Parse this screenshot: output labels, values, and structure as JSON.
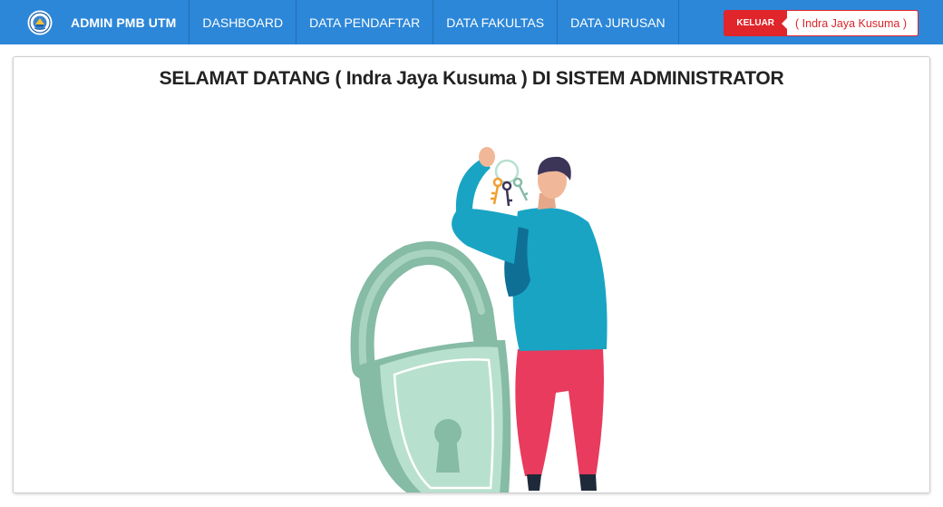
{
  "navbar": {
    "brand": "ADMIN PMB UTM",
    "items": [
      {
        "label": "DASHBOARD"
      },
      {
        "label": "DATA PENDAFTAR"
      },
      {
        "label": "DATA FAKULTAS"
      },
      {
        "label": "DATA JURUSAN"
      }
    ],
    "logout_label": "KELUAR",
    "user_label": "( Indra Jaya Kusuma )"
  },
  "main": {
    "welcome_title": "SELAMAT DATANG ( Indra Jaya Kusuma ) DI SISTEM ADMINISTRATOR"
  },
  "colors": {
    "navbar": "#2c87d8",
    "logout": "#e0252b",
    "shirt": "#19a4c4",
    "pants": "#e83b5e",
    "padlock": "#86bba6"
  },
  "icons": {
    "logo": "university-logo-icon",
    "illustration": "padlock-keys-illustration"
  }
}
